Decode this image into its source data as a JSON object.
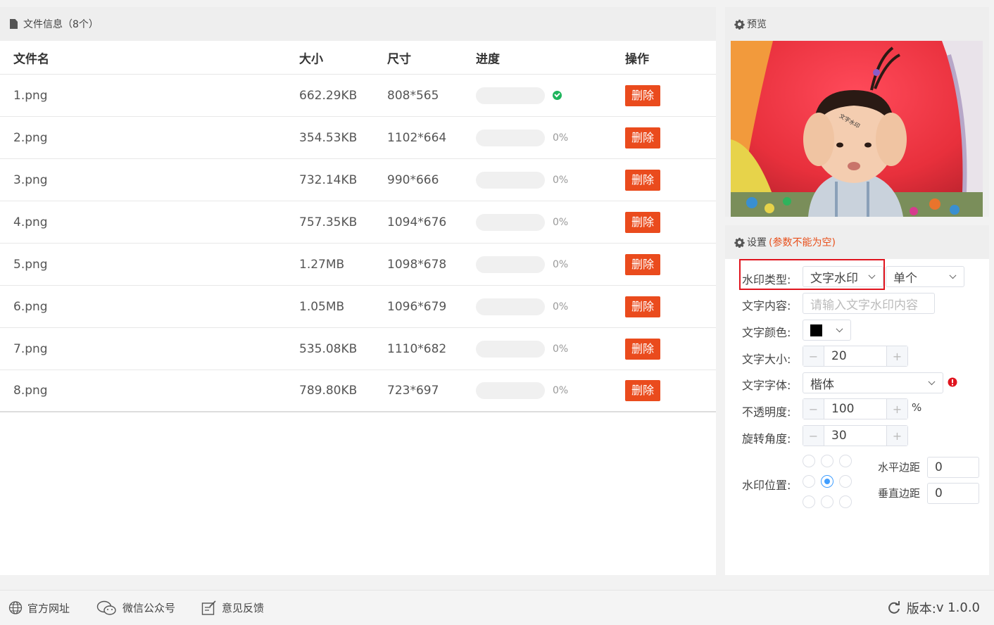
{
  "files_panel": {
    "title": "文件信息（8个）",
    "columns": [
      "文件名",
      "大小",
      "尺寸",
      "进度",
      "操作"
    ],
    "rows": [
      {
        "name": "1.png",
        "size": "662.29KB",
        "dims": "808*565",
        "progress": 1.0,
        "pct": "",
        "action": "删除"
      },
      {
        "name": "2.png",
        "size": "354.53KB",
        "dims": "1102*664",
        "progress": 0,
        "pct": "0%",
        "action": "删除"
      },
      {
        "name": "3.png",
        "size": "732.14KB",
        "dims": "990*666",
        "progress": 0,
        "pct": "0%",
        "action": "删除"
      },
      {
        "name": "4.png",
        "size": "757.35KB",
        "dims": "1094*676",
        "progress": 0,
        "pct": "0%",
        "action": "删除"
      },
      {
        "name": "5.png",
        "size": "1.27MB",
        "dims": "1098*678",
        "progress": 0,
        "pct": "0%",
        "action": "删除"
      },
      {
        "name": "6.png",
        "size": "1.05MB",
        "dims": "1096*679",
        "progress": 0,
        "pct": "0%",
        "action": "删除"
      },
      {
        "name": "7.png",
        "size": "535.08KB",
        "dims": "1110*682",
        "progress": 0,
        "pct": "0%",
        "action": "删除"
      },
      {
        "name": "8.png",
        "size": "789.80KB",
        "dims": "723*697",
        "progress": 0,
        "pct": "0%",
        "action": "删除"
      }
    ]
  },
  "preview": {
    "title": "预览",
    "watermark_text": "文字水印"
  },
  "settings": {
    "title": "设置",
    "note": "(参数不能为空)",
    "watermark_type_label": "水印类型:",
    "watermark_type_value": "文字水印",
    "mode_value": "单个",
    "text_content_label": "文字内容:",
    "text_content_placeholder": "请输入文字水印内容",
    "text_color_label": "文字颜色:",
    "text_color_value": "#000000",
    "text_size_label": "文字大小:",
    "text_size_value": "20",
    "font_label": "文字字体:",
    "font_value": "楷体",
    "opacity_label": "不透明度:",
    "opacity_value": "100",
    "opacity_unit": "%",
    "rotation_label": "旋转角度:",
    "rotation_value": "30",
    "position_label": "水印位置:",
    "position_selected": "middle-center",
    "h_margin_label": "水平边距",
    "h_margin_value": "0",
    "v_margin_label": "垂直边距",
    "v_margin_value": "0",
    "minus": "−",
    "plus": "+"
  },
  "footer": {
    "official_site": "官方网址",
    "wechat": "微信公众号",
    "feedback": "意见反馈",
    "version_label": "版本: ",
    "version_value": "v 1.0.0"
  },
  "colors": {
    "accent_red": "#ea4b1d",
    "progress_green": "#1eb45c",
    "radio_blue": "#409eff",
    "highlight_red": "#e0141e"
  },
  "icons": [
    "document-icon",
    "gear-icon",
    "check-circle-icon",
    "chevron-down-icon",
    "alert-icon",
    "globe-icon",
    "wechat-icon",
    "feedback-icon",
    "refresh-icon"
  ]
}
